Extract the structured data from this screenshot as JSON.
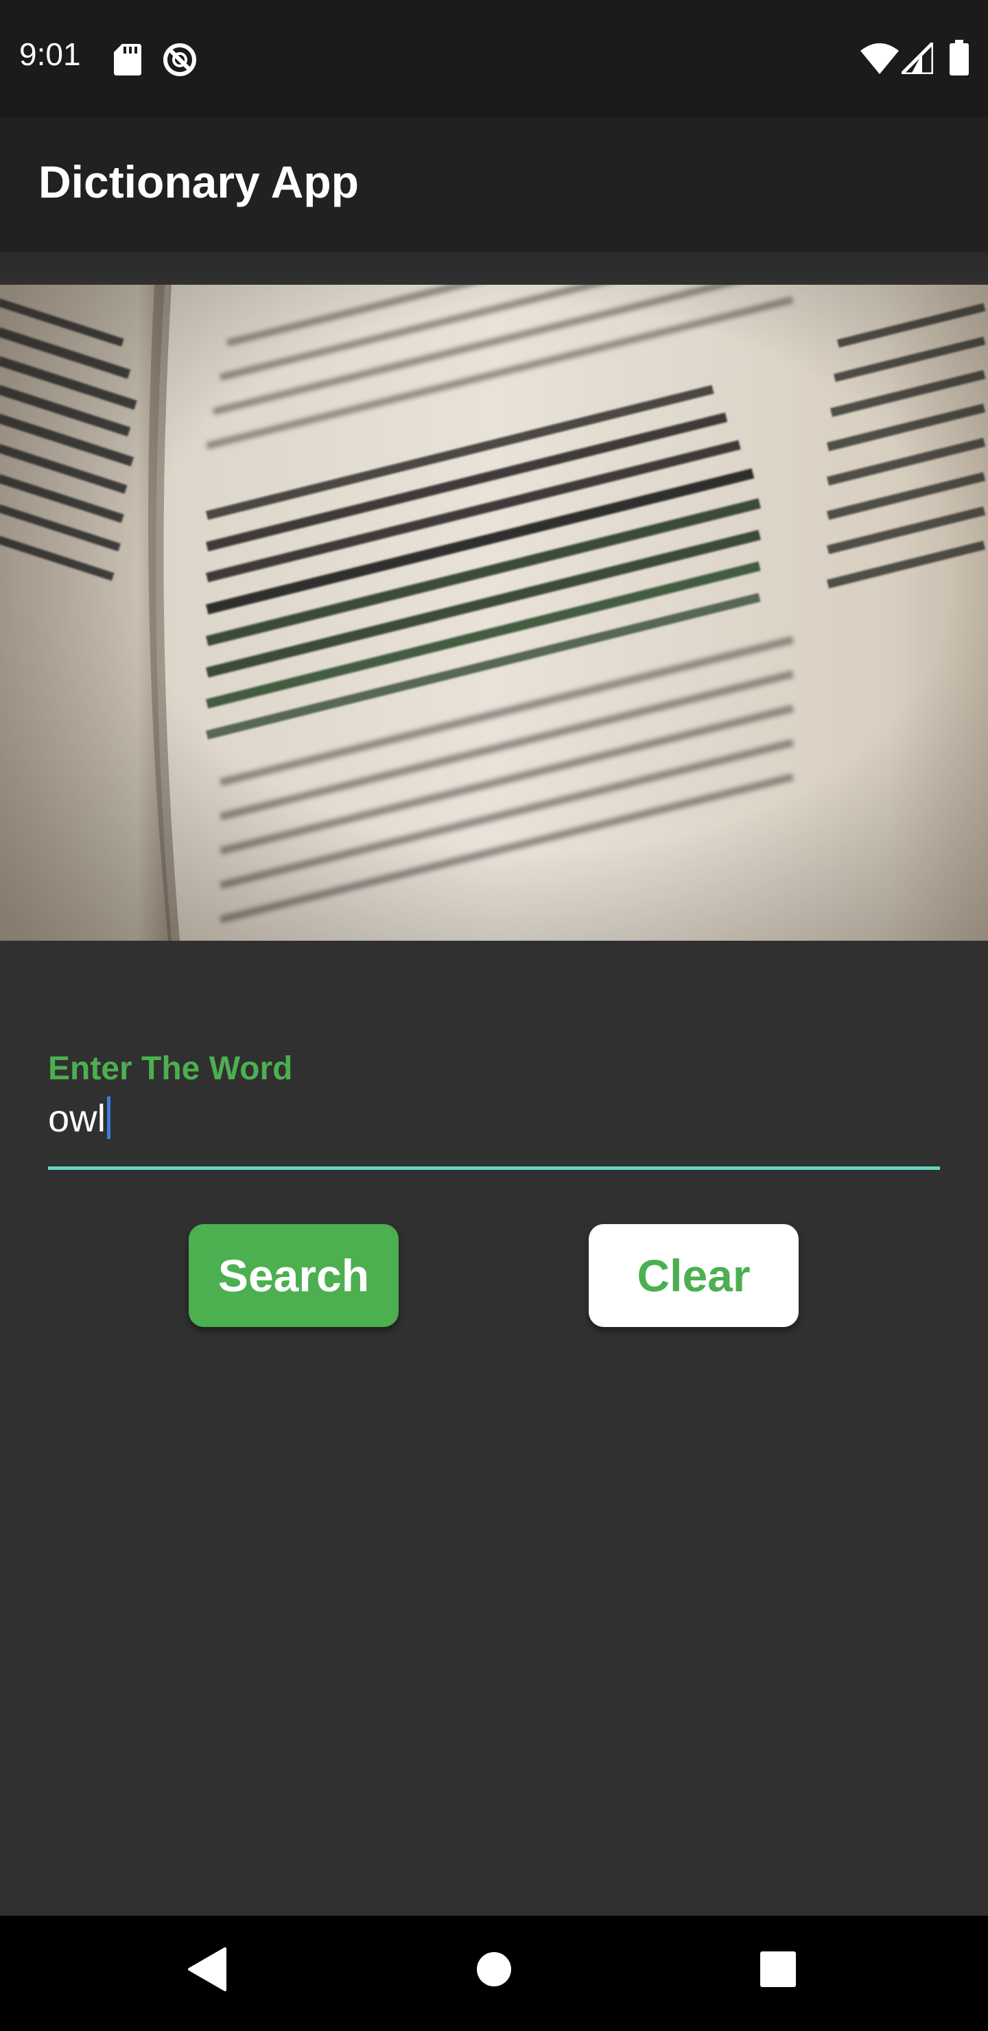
{
  "status_bar": {
    "time": "9:01",
    "icons": [
      "sd-card-icon",
      "sync-disabled-icon",
      "wifi-icon",
      "signal-icon",
      "battery-icon"
    ]
  },
  "app_bar": {
    "title": "Dictionary App"
  },
  "hero_image": {
    "description_icon": "dictionary-page-image"
  },
  "search_field": {
    "label": "Enter The Word",
    "value": "owl"
  },
  "buttons": {
    "search_label": "Search",
    "clear_label": "Clear"
  },
  "colors": {
    "accent": "#4caf50",
    "underline": "#64d8c3",
    "background": "#303030",
    "app_bar": "#212121"
  },
  "nav_bar": {
    "icons": [
      "back-icon",
      "home-icon",
      "recents-icon"
    ]
  }
}
